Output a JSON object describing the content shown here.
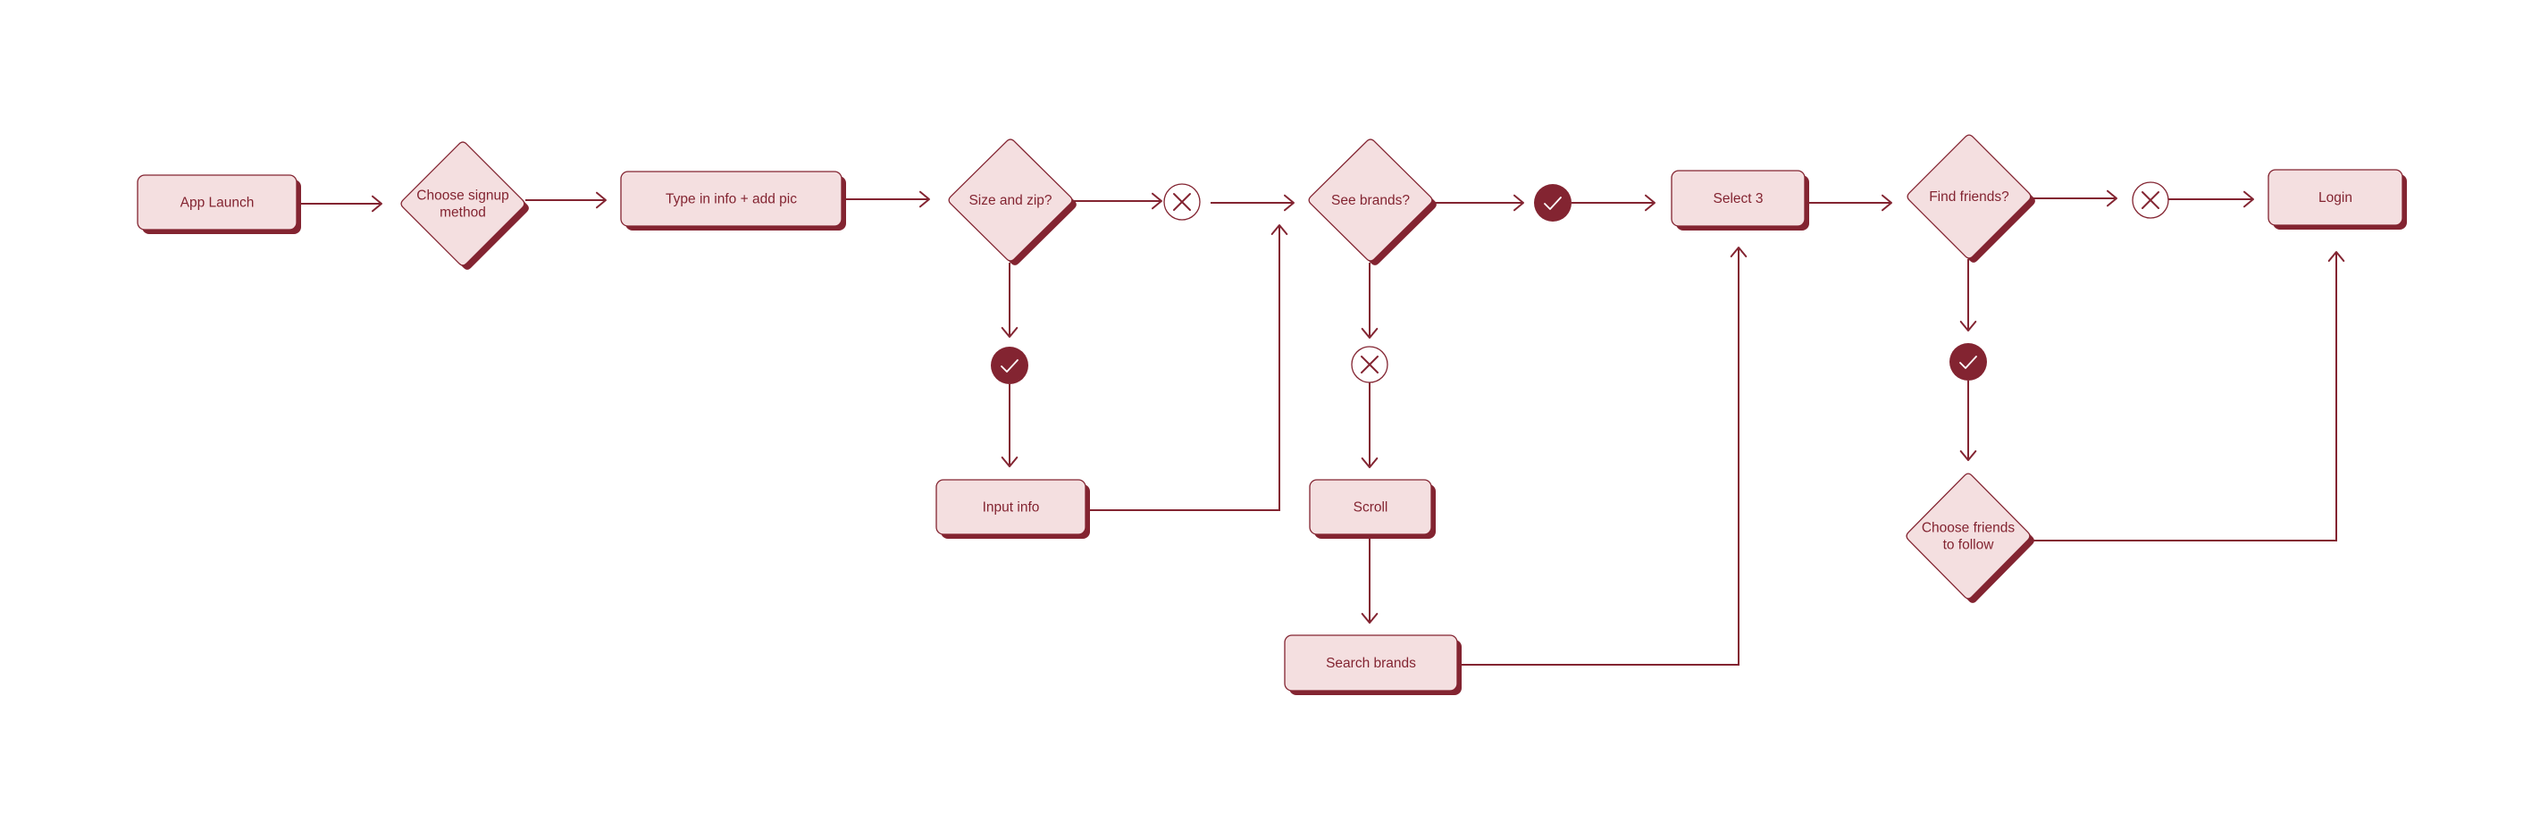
{
  "diagram": {
    "type": "user-flow",
    "colors": {
      "primary": "#832431",
      "node_fill": "#f4dfe0",
      "background": "#ffffff",
      "check_mark": "#ffffff"
    },
    "nodes": {
      "app_launch": {
        "kind": "process",
        "label": "App Launch"
      },
      "choose_signup": {
        "kind": "decision",
        "label": [
          "Choose signup",
          "method"
        ]
      },
      "type_info": {
        "kind": "process",
        "label": "Type in info + add pic"
      },
      "size_zip": {
        "kind": "decision",
        "label": [
          "Size and zip?"
        ]
      },
      "input_info": {
        "kind": "process",
        "label": "Input info"
      },
      "see_brands": {
        "kind": "decision",
        "label": [
          "See brands?"
        ]
      },
      "scroll": {
        "kind": "process",
        "label": "Scroll"
      },
      "search_brands": {
        "kind": "process",
        "label": "Search brands"
      },
      "select_3": {
        "kind": "process",
        "label": "Select 3"
      },
      "find_friends": {
        "kind": "decision",
        "label": [
          "Find friends?"
        ]
      },
      "choose_friends": {
        "kind": "decision",
        "label": [
          "Choose friends",
          "to follow"
        ]
      },
      "login": {
        "kind": "process",
        "label": "Login"
      }
    },
    "statuses": {
      "size_zip_no": {
        "value": "no",
        "icon": "x-icon"
      },
      "size_zip_yes": {
        "value": "yes",
        "icon": "check-icon"
      },
      "see_brands_yes": {
        "value": "yes",
        "icon": "check-icon"
      },
      "see_brands_no": {
        "value": "no",
        "icon": "x-icon"
      },
      "find_friends_no": {
        "value": "no",
        "icon": "x-icon"
      },
      "find_friends_yes": {
        "value": "yes",
        "icon": "check-icon"
      }
    },
    "edges": [
      {
        "from": "app_launch",
        "to": "choose_signup"
      },
      {
        "from": "choose_signup",
        "to": "type_info"
      },
      {
        "from": "type_info",
        "to": "size_zip"
      },
      {
        "from": "size_zip",
        "to": "size_zip_no"
      },
      {
        "from": "size_zip_no",
        "to": "see_brands"
      },
      {
        "from": "size_zip",
        "to": "size_zip_yes"
      },
      {
        "from": "size_zip_yes",
        "to": "input_info"
      },
      {
        "from": "input_info",
        "to": "see_brands"
      },
      {
        "from": "see_brands",
        "to": "see_brands_yes"
      },
      {
        "from": "see_brands_yes",
        "to": "select_3"
      },
      {
        "from": "see_brands",
        "to": "see_brands_no"
      },
      {
        "from": "see_brands_no",
        "to": "scroll"
      },
      {
        "from": "scroll",
        "to": "search_brands"
      },
      {
        "from": "search_brands",
        "to": "select_3"
      },
      {
        "from": "select_3",
        "to": "find_friends"
      },
      {
        "from": "find_friends",
        "to": "find_friends_no"
      },
      {
        "from": "find_friends_no",
        "to": "login"
      },
      {
        "from": "find_friends",
        "to": "find_friends_yes"
      },
      {
        "from": "find_friends_yes",
        "to": "choose_friends"
      },
      {
        "from": "choose_friends",
        "to": "login"
      }
    ]
  }
}
